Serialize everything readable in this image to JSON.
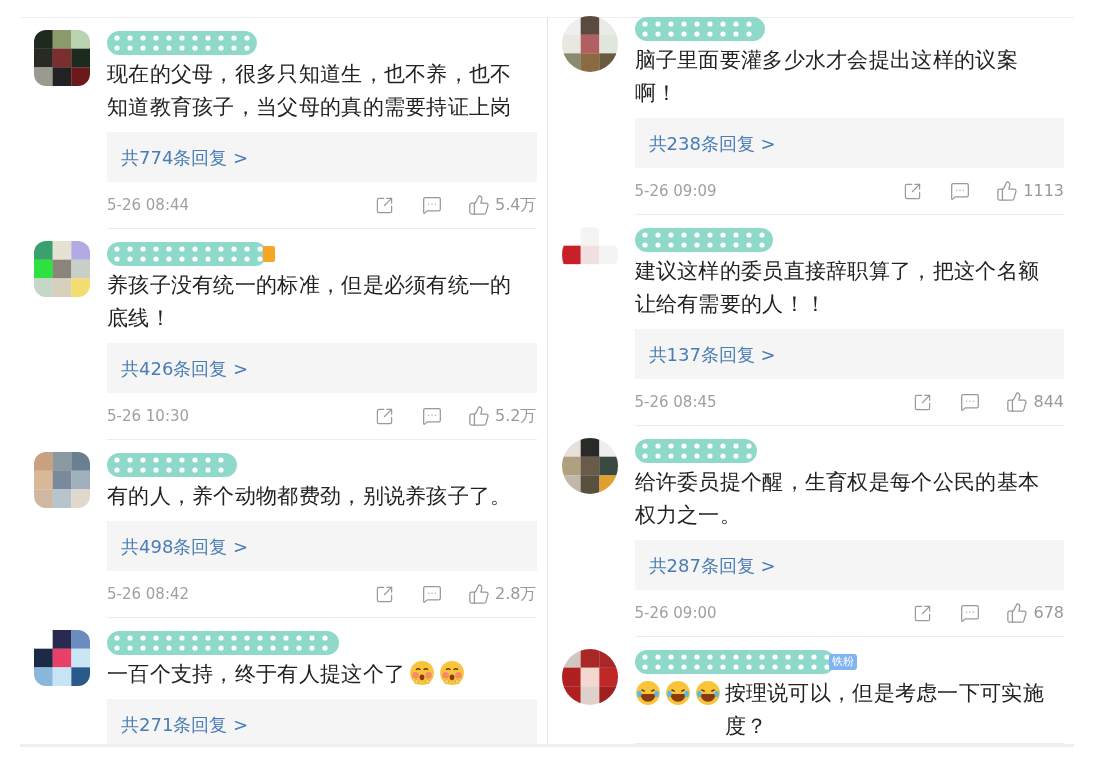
{
  "columns": [
    {
      "comments": [
        {
          "body": [
            {
              "kind": "text",
              "text": "现在的父母，很多只知道生，也不养，也不知道教育孩子，当父母的真的需要持证上岗"
            }
          ],
          "replies": "共774条回复 >",
          "time": "5-26 08:44",
          "likes": "5.4万"
        },
        {
          "badge": {
            "kind": "level"
          },
          "body": [
            {
              "kind": "text",
              "text": "养孩子没有统一的标准，但是必须有统一的底线！"
            }
          ],
          "replies": "共426条回复 >",
          "time": "5-26 10:30",
          "likes": "5.2万"
        },
        {
          "body": [
            {
              "kind": "text",
              "text": "有的人，养个动物都费劲，别说养孩子了。"
            }
          ],
          "replies": "共498条回复 >",
          "time": "5-26 08:42",
          "likes": "2.8万"
        },
        {
          "body": [
            {
              "kind": "text",
              "text": "一百个支持，终于有人提这个了"
            },
            {
              "kind": "blush"
            },
            {
              "kind": "blush"
            }
          ],
          "replies": "共271条回复 >"
        }
      ]
    },
    {
      "comments": [
        {
          "body": [
            {
              "kind": "text",
              "text": "脑子里面要灌多少水才会提出这样的议案啊！"
            }
          ],
          "replies": "共238条回复 >",
          "time": "5-26 09:09",
          "likes": "1113"
        },
        {
          "body": [
            {
              "kind": "text",
              "text": "建议这样的委员直接辞职算了，把这个名额让给有需要的人！！"
            }
          ],
          "replies": "共137条回复 >",
          "time": "5-26 08:45",
          "likes": "844"
        },
        {
          "body": [
            {
              "kind": "text",
              "text": "给许委员提个醒，生育权是每个公民的基本权力之一。"
            }
          ],
          "replies": "共287条回复 >",
          "time": "5-26 09:00",
          "likes": "678"
        },
        {
          "badge": {
            "kind": "fan",
            "text": "铁粉"
          },
          "body": [
            {
              "kind": "laugh"
            },
            {
              "kind": "laugh"
            },
            {
              "kind": "laugh"
            },
            {
              "kind": "text",
              "text": "按理说可以，但是考虑一下可实施度？"
            }
          ]
        }
      ]
    }
  ]
}
